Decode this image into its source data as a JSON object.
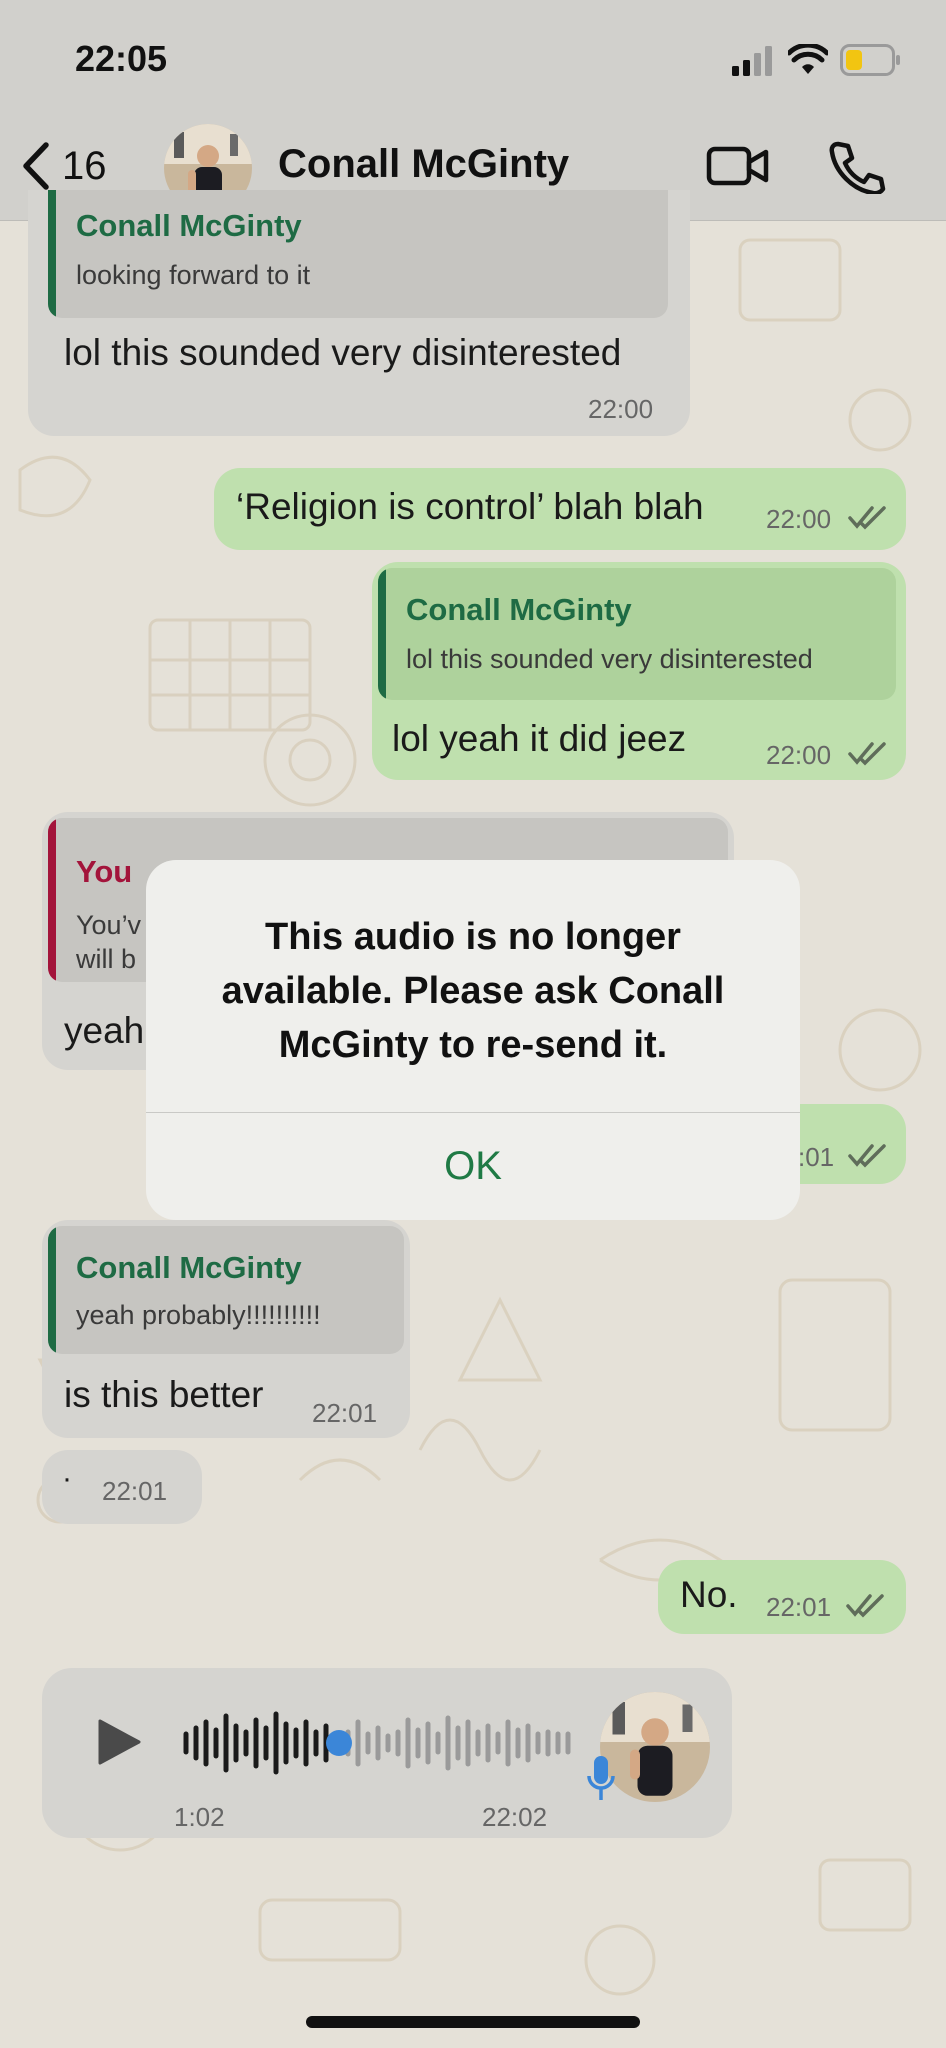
{
  "status_bar": {
    "time": "22:05"
  },
  "header": {
    "back_count": "16",
    "contact_name": "Conall McGinty"
  },
  "messages": {
    "m1": {
      "quote_name": "Conall McGinty",
      "quote_text": "looking forward to it",
      "text": "lol this sounded very disinterested",
      "time": "22:00"
    },
    "m2": {
      "text": "‘Religion is control’ blah blah",
      "time": "22:00"
    },
    "m3": {
      "quote_name": "Conall McGinty",
      "quote_text": "lol this sounded very disinterested",
      "text": "lol yeah it did jeez",
      "time": "22:00"
    },
    "m4": {
      "quote_name": "You",
      "quote_line1": "You’v",
      "quote_line2": "will b",
      "text": "yeah"
    },
    "m5": {
      "time_partial": ":01"
    },
    "m6": {
      "quote_name": "Conall McGinty",
      "quote_text": "yeah probably!!!!!!!!!!",
      "text": "is this better",
      "time": "22:01"
    },
    "m7": {
      "text": "·",
      "time": "22:01"
    },
    "m8": {
      "text": "No.",
      "time": "22:01"
    }
  },
  "voice_message": {
    "duration": "1:02",
    "time": "22:02",
    "progress": 0.38
  },
  "dialog": {
    "message": "This audio is no longer available. Please ask Conall McGinty to re-send it.",
    "ok_label": "OK"
  },
  "colors": {
    "accent_green": "#1f7a45",
    "quote_name_green": "#1e6b44",
    "you_red": "#a3143b",
    "outgoing_bubble": "#bfe0ae",
    "incoming_bubble": "#d5d4d0",
    "voice_blue": "#3b86d8"
  },
  "icons": [
    "chevron-left-icon",
    "video-camera-icon",
    "phone-icon",
    "signal-icon",
    "wifi-icon",
    "battery-icon",
    "play-icon",
    "microphone-icon",
    "double-check-icon"
  ]
}
